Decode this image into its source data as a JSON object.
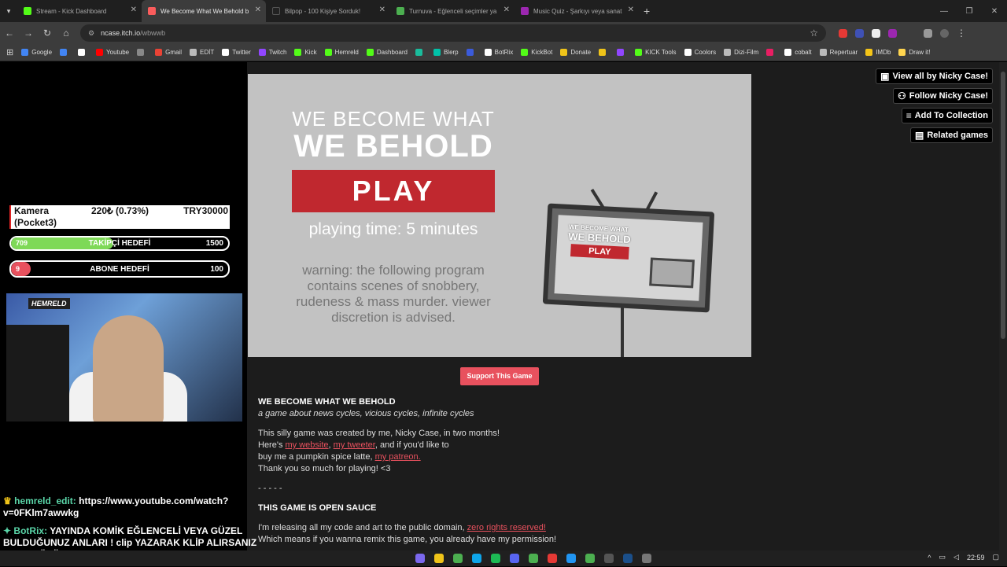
{
  "tabs": [
    {
      "title": "Stream - Kick Dashboard",
      "color": "#53fc18",
      "active": false
    },
    {
      "title": "We Become What We Behold b",
      "color": "#fa5c5c",
      "active": true
    },
    {
      "title": "Bilpop - 100 Kişiye Sorduk!",
      "color": "#222222",
      "active": false
    },
    {
      "title": "Turnuva - Eğlenceli seçimler ya",
      "color": "#4caf50",
      "active": false
    },
    {
      "title": "Music Quiz - Şarkıyı veya sanat",
      "color": "#9c27b0",
      "active": false
    }
  ],
  "url": {
    "host": "ncase.itch.io",
    "path": "/wbwwb"
  },
  "bookmarks": [
    {
      "label": "Google",
      "color": "#4285f4"
    },
    {
      "label": "",
      "color": "#4285f4"
    },
    {
      "label": "",
      "color": "#ffffff"
    },
    {
      "label": "Youtube",
      "color": "#ff0000"
    },
    {
      "label": "",
      "color": "#888888"
    },
    {
      "label": "Gmail",
      "color": "#ea4335"
    },
    {
      "label": "EDİT",
      "color": "#bbbbbb"
    },
    {
      "label": "Twitter",
      "color": "#ffffff"
    },
    {
      "label": "Twitch",
      "color": "#9146ff"
    },
    {
      "label": "Kick",
      "color": "#53fc18"
    },
    {
      "label": "Hemreld",
      "color": "#53fc18"
    },
    {
      "label": "Dashboard",
      "color": "#53fc18"
    },
    {
      "label": "",
      "color": "#1abc9c"
    },
    {
      "label": "Blerp",
      "color": "#00c2a8"
    },
    {
      "label": "",
      "color": "#3b5bdb"
    },
    {
      "label": "BotRix",
      "color": "#ffffff"
    },
    {
      "label": "KickBot",
      "color": "#53fc18"
    },
    {
      "label": "Donate",
      "color": "#f0c419"
    },
    {
      "label": "",
      "color": "#f0c419"
    },
    {
      "label": "",
      "color": "#9146ff"
    },
    {
      "label": "KICK Tools",
      "color": "#53fc18"
    },
    {
      "label": "Coolors",
      "color": "#ffffff"
    },
    {
      "label": "Dizi-Film",
      "color": "#bbbbbb"
    },
    {
      "label": "",
      "color": "#e91e63"
    },
    {
      "label": "cobalt",
      "color": "#ffffff"
    },
    {
      "label": "Repertuar",
      "color": "#bbbbbb"
    },
    {
      "label": "IMDb",
      "color": "#f5c518"
    },
    {
      "label": "Draw it!",
      "color": "#ffd54f"
    }
  ],
  "overlay": {
    "ticker": {
      "name": "Kamera (Pocket3)",
      "price": "220₺ (0.73%)",
      "goal": "TRY30000"
    },
    "follower_goal": {
      "current": "709",
      "label": "TAKİPÇİ HEDEFİ",
      "target": "1500",
      "progress": 0.47,
      "color": "#7ed957"
    },
    "sub_goal": {
      "current": "9",
      "label": "ABONE HEDEFİ",
      "target": "100",
      "progress": 0.09,
      "color": "#e8515e"
    },
    "cam_logo": "HEMRELD"
  },
  "game": {
    "title_line1": "WE BECOME WHAT",
    "title_line2": "WE BEHOLD",
    "play": "PLAY",
    "time": "playing time: 5 minutes",
    "warning": "warning: the following program contains scenes of snobbery, rudeness & mass murder. viewer discretion is advised.",
    "tv_title1": "WE BECOME WHAT",
    "tv_title2": "WE BEHOLD",
    "tv_play": "PLAY"
  },
  "side_buttons": [
    {
      "label": "View all by Nicky Case!",
      "icon": "gamepad-icon"
    },
    {
      "label": "Follow Nicky Case!",
      "icon": "add-user-icon"
    },
    {
      "label": "Add To Collection",
      "icon": "list-add-icon"
    },
    {
      "label": "Related games",
      "icon": "map-icon"
    }
  ],
  "support_button": "Support This Game",
  "description": {
    "heading": "WE BECOME WHAT WE BEHOLD",
    "subtitle": "a game about news cycles, vicious cycles, infinite cycles",
    "p1_line1": "This silly game was created by me, Nicky Case, in two months!",
    "p1_heres": "Here's ",
    "link_website": "my website",
    "comma": ", ",
    "link_tweeter": "my tweeter",
    "p1_line2_end": ", and if you'd like to",
    "p1_line3": "buy me a pumpkin spice latte, ",
    "link_patreon": "my patreon.",
    "p1_line4": "Thank you so much for playing! <3",
    "divider": "- - - - -",
    "heading2": "THIS GAME IS OPEN SAUCE",
    "p2_line1": "I'm releasing all my code and art to the public domain, ",
    "link_zero": "zero rights reserved!",
    "p2_line2": "Which means if you wanna remix this game, you already have my permission!"
  },
  "chat": [
    {
      "user": "hemreld_edit:",
      "text": "https://www.youtube.com/watch?v=0FKlm7awwkg"
    },
    {
      "user": "BotRix:",
      "text": "YAYINDA KOMİK EĞLENCELİ VEYA GÜZEL BULDUĞUNUZ ANLARI ! clip YAZARAK KLİP ALIRSANIZ BANA BÜYÜK DESTEK OLMUŞ OLURSUNUZ. TŞK."
    }
  ],
  "taskbar": {
    "time": "22:59"
  }
}
